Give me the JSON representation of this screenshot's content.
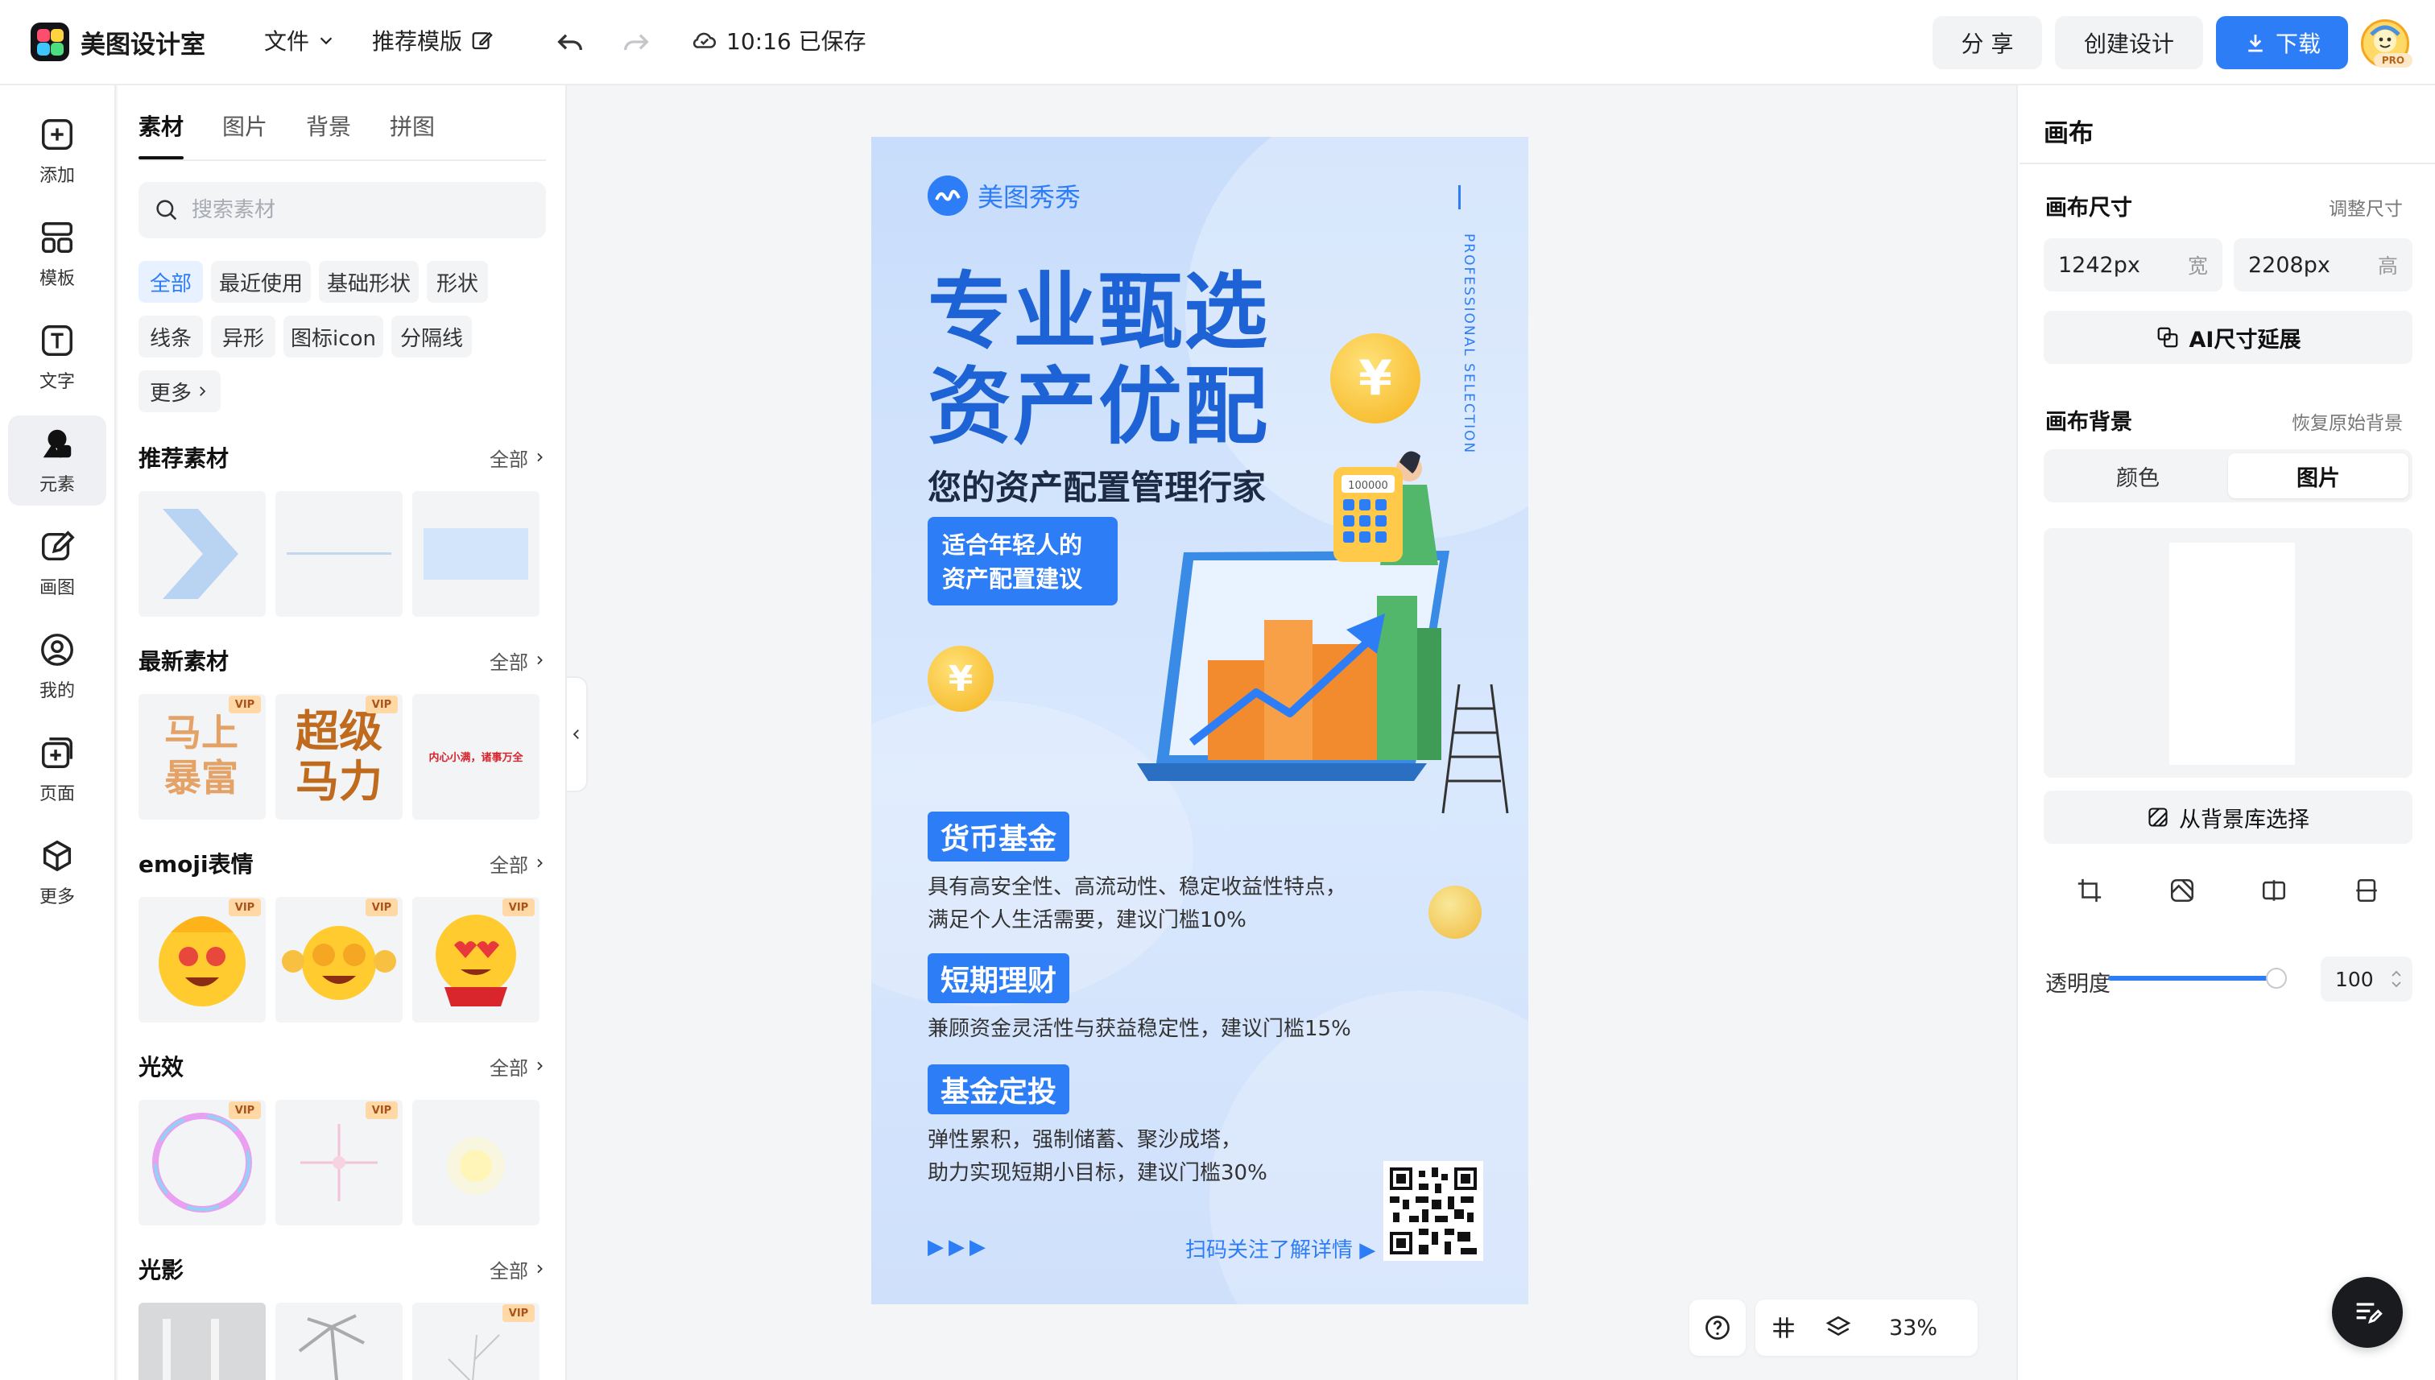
{
  "app": {
    "title": "美图设计室",
    "menu_file": "文件",
    "menu_template": "推荐模版",
    "save_status": "10:16 已保存",
    "share_label": "分 享",
    "create_label": "创建设计",
    "download_label": "下载",
    "avatar_badge": "PRO"
  },
  "rail": {
    "items": [
      {
        "label": "添加",
        "icon": "plus-square-icon"
      },
      {
        "label": "模板",
        "icon": "template-icon"
      },
      {
        "label": "文字",
        "icon": "text-icon"
      },
      {
        "label": "元素",
        "icon": "shapes-icon"
      },
      {
        "label": "画图",
        "icon": "draw-icon"
      },
      {
        "label": "我的",
        "icon": "user-icon"
      },
      {
        "label": "页面",
        "icon": "page-add-icon"
      },
      {
        "label": "更多",
        "icon": "cube-icon"
      }
    ],
    "active_index": 3
  },
  "assets": {
    "tabs": [
      "素材",
      "图片",
      "背景",
      "拼图"
    ],
    "active_tab": "素材",
    "search_placeholder": "搜索素材",
    "chips": [
      "全部",
      "最近使用",
      "基础形状",
      "形状",
      "线条",
      "异形",
      "图标icon",
      "分隔线",
      "更多"
    ],
    "active_chip": "全部",
    "more_label": "全部",
    "vip_label": "VIP",
    "sections": [
      {
        "title": "推荐素材"
      },
      {
        "title": "最新素材",
        "thumb_texts": [
          "马上暴富",
          "超级马力",
          "内心小满，诸事万全"
        ]
      },
      {
        "title": "emoji表情"
      },
      {
        "title": "光效"
      },
      {
        "title": "光影"
      }
    ]
  },
  "poster": {
    "brand": "美图秀秀",
    "vertical_text": "PROFESSIONAL SELECTION",
    "title_line1": "专业甄选",
    "title_line2": "资产优配",
    "subtitle": "您的资产配置管理行家",
    "tag_line1": "适合年轻人的",
    "tag_line2": "资产配置建议",
    "calc_display": "100000",
    "coin_symbol": "¥",
    "sec1_title": "货币基金",
    "sec1_text1": "具有高安全性、高流动性、稳定收益性特点，",
    "sec1_text2": "满足个人生活需要，建议门槛10%",
    "sec2_title": "短期理财",
    "sec2_text1": "兼顾资金灵活性与获益稳定性，建议门槛15%",
    "sec3_title": "基金定投",
    "sec3_text1": "弹性累积，强制储蓄、聚沙成塔，",
    "sec3_text2": "助力实现短期小目标，建议门槛30%",
    "arrows": "▶▶▶",
    "scan_text": "扫码关注了解详情 ▶"
  },
  "canvas_tools": {
    "zoom": "33%"
  },
  "right_panel": {
    "title": "画布",
    "size_label": "画布尺寸",
    "resize_link": "调整尺寸",
    "width_value": "1242px",
    "width_unit": "宽",
    "height_value": "2208px",
    "height_unit": "高",
    "ai_extend": "AI尺寸延展",
    "bg_label": "画布背景",
    "restore_link": "恢复原始背景",
    "seg_color": "颜色",
    "seg_image": "图片",
    "from_library": "从背景库选择",
    "opacity_label": "透明度",
    "opacity_value": "100",
    "opacity_fraction": 1.0
  },
  "colors": {
    "accent": "#2d7df6",
    "poster_bg": "#c8ddfb",
    "poster_title": "#1e63d6"
  }
}
